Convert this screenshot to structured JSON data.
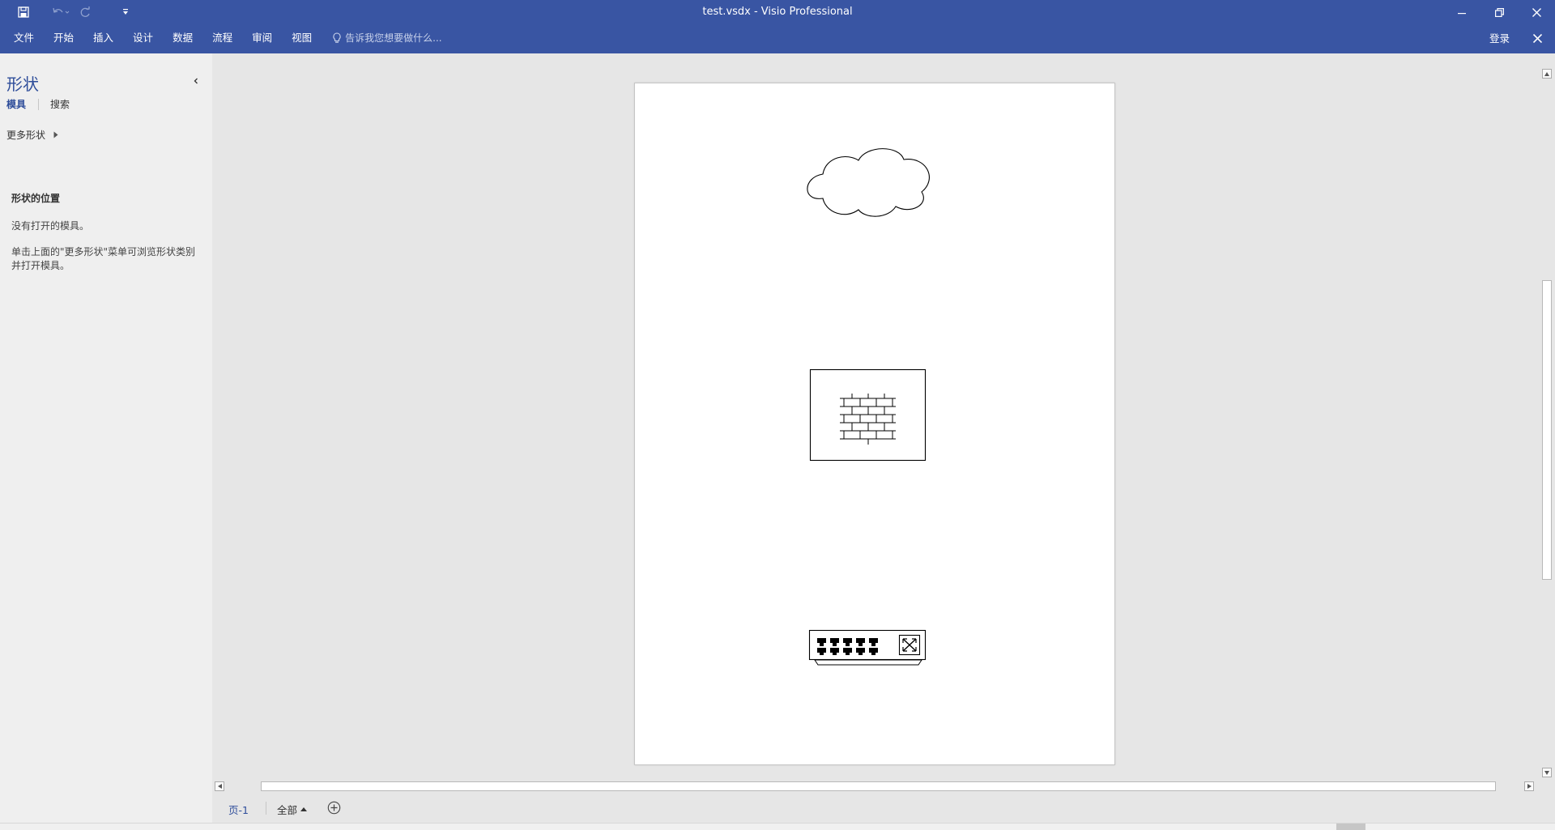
{
  "window": {
    "title": "test.vsdx - Visio Professional"
  },
  "ribbon": {
    "tabs": [
      "文件",
      "开始",
      "插入",
      "设计",
      "数据",
      "流程",
      "审阅",
      "视图"
    ],
    "tell_me_placeholder": "告诉我您想要做什么...",
    "sign_in": "登录"
  },
  "shapes_pane": {
    "title": "形状",
    "tab_stencils": "模具",
    "tab_search": "搜索",
    "more_shapes": "更多形状",
    "info_title": "形状的位置",
    "info_no_stencils": "没有打开的模具。",
    "info_hint": "单击上面的\"更多形状\"菜单可浏览形状类别并打开模具。"
  },
  "page_tabs": {
    "current": "页-1",
    "all": "全部"
  },
  "icons": {
    "save": "save-icon",
    "undo": "undo-icon",
    "redo": "redo-icon",
    "customize": "customize-qat-icon",
    "lightbulb": "lightbulb-icon",
    "cloud": "cloud-shape",
    "firewall": "firewall-shape",
    "switch": "switch-shape"
  },
  "colors": {
    "accent": "#3955a3",
    "pane_title": "#2e4d9a",
    "canvas": "#e6e6e6",
    "page": "#ffffff"
  }
}
